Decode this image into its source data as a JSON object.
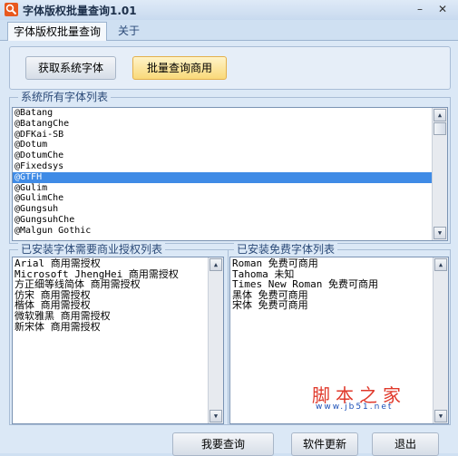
{
  "window": {
    "title": "字体版权批量查询1.01",
    "minimize_glyph": "–",
    "close_glyph": "✕"
  },
  "tabs": [
    {
      "label": "字体版权批量查询",
      "active": true
    },
    {
      "label": "关于",
      "active": false
    }
  ],
  "toolbar": {
    "get_fonts_label": "获取系统字体",
    "batch_query_label": "批量查询商用"
  },
  "font_list": {
    "title": "系统所有字体列表",
    "selected_index": 6,
    "items": [
      "@Batang",
      "@BatangChe",
      "@DFKai-SB",
      "@Dotum",
      "@DotumChe",
      "@Fixedsys",
      "@GTFH",
      "@Gulim",
      "@GulimChe",
      "@Gungsuh",
      "@GungsuhChe",
      "@Malgun Gothic"
    ]
  },
  "license_list": {
    "title": "已安装字体需要商业授权列表",
    "items": [
      "Arial 商用需授权",
      "Microsoft JhengHei 商用需授权",
      "方正细等线简体 商用需授权",
      "仿宋 商用需授权",
      "楷体 商用需授权",
      "微软雅黑 商用需授权",
      "新宋体 商用需授权"
    ]
  },
  "free_list": {
    "title": "已安装免费字体列表",
    "items": [
      "Roman 免费可商用",
      "Tahoma 未知",
      "Times New Roman 免费可商用",
      "黑体 免费可商用",
      "宋体 免费可商用"
    ]
  },
  "watermark": {
    "main": "脚本之家",
    "sub": "www.jb51.net"
  },
  "footer": {
    "query_label": "我要查询",
    "update_label": "软件更新",
    "exit_label": "退出"
  },
  "icons": {
    "app": "magnifier-icon",
    "scroll_up": "triangle-up-icon",
    "scroll_down": "triangle-down-icon"
  },
  "colors": {
    "selection": "#3f8be6",
    "highlight_button": "#f9d979",
    "watermark": "#e0392b",
    "app_icon": "#e8581e"
  }
}
